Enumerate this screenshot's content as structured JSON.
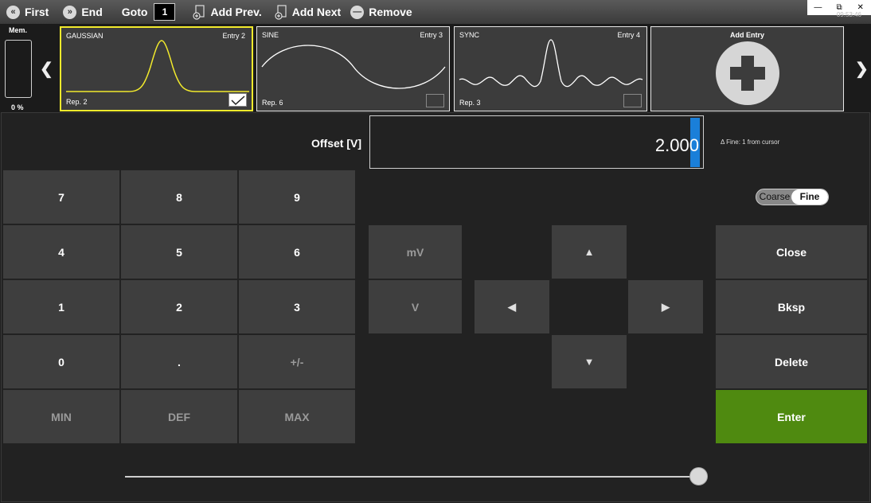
{
  "toolbar": {
    "first": "First",
    "end": "End",
    "goto": "Goto",
    "goto_value": "1",
    "add_prev": "Add Prev.",
    "add_next": "Add Next",
    "remove": "Remove"
  },
  "window": {
    "minimize": "—",
    "restore": "⧉",
    "close": "✕",
    "clock": "09:53:46"
  },
  "memory": {
    "label": "Mem.",
    "percent": "0 %"
  },
  "entries": [
    {
      "name": "GAUSSIAN",
      "entry": "Entry  2",
      "rep": "Rep.  2",
      "selected": true,
      "checked": true,
      "color": "#f2ea2c"
    },
    {
      "name": "SINE",
      "entry": "Entry  3",
      "rep": "Rep.  6",
      "selected": false,
      "checked": false,
      "color": "#ffffff"
    },
    {
      "name": "SYNC",
      "entry": "Entry  4",
      "rep": "Rep.  3",
      "selected": false,
      "checked": false,
      "color": "#ffffff"
    }
  ],
  "add_entry": {
    "label": "Add Entry"
  },
  "offset": {
    "label": "Offset [V]",
    "value_main": "2.00",
    "value_cursor": "0",
    "fine_note": "Δ Fine: 1 from cursor"
  },
  "mode_toggle": {
    "coarse": "Coarse",
    "fine": "Fine",
    "selected": "Fine"
  },
  "keypad": {
    "k7": "7",
    "k8": "8",
    "k9": "9",
    "k4": "4",
    "k5": "5",
    "k6": "6",
    "k1": "1",
    "k2": "2",
    "k3": "3",
    "k0": "0",
    "kdot": ".",
    "ksign": "+/-",
    "kmin": "MIN",
    "kdef": "DEF",
    "kmax": "MAX"
  },
  "units": {
    "mv": "mV",
    "v": "V"
  },
  "arrows": {
    "up": "▲",
    "down": "▼",
    "left": "◀",
    "right": "▶"
  },
  "actions": {
    "close": "Close",
    "bksp": "Bksp",
    "delete": "Delete",
    "enter": "Enter"
  },
  "slider": {
    "position_fraction": 0.99
  },
  "colors": {
    "enter": "#4f8a10",
    "cursor": "#1a7fd9",
    "selected_border": "#f2ea2c"
  }
}
